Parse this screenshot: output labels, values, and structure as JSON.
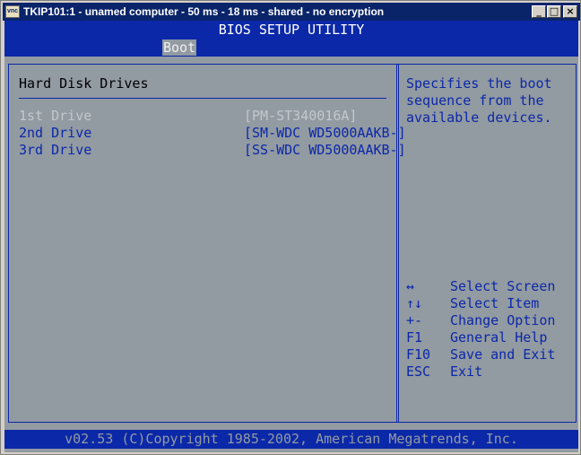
{
  "window": {
    "title": "TKIP101:1 - unamed computer - 50 ms - 18 ms - shared - no encryption",
    "icon_label": "vnc",
    "minimize_glyph": "_",
    "maximize_glyph": "□",
    "close_glyph": "×"
  },
  "bios": {
    "header": "BIOS SETUP UTILITY",
    "menu": {
      "boot_label": "Boot"
    },
    "section_title": "Hard Disk Drives",
    "drives": [
      {
        "label": "1st Drive",
        "value": "[PM-ST340016A]"
      },
      {
        "label": "2nd Drive",
        "value": "[SM-WDC WD5000AAKB-]"
      },
      {
        "label": "3rd Drive",
        "value": "[SS-WDC WD5000AAKB-]"
      }
    ],
    "help_text": "Specifies the boot sequence from the available devices.",
    "keys": [
      {
        "key": "↔",
        "desc": "Select Screen"
      },
      {
        "key": "↑↓",
        "desc": "Select Item"
      },
      {
        "key": "+-",
        "desc": "Change Option"
      },
      {
        "key": "F1",
        "desc": "General Help"
      },
      {
        "key": "F10",
        "desc": "Save and Exit"
      },
      {
        "key": "ESC",
        "desc": "Exit"
      }
    ],
    "footer": "v02.53 (C)Copyright 1985-2002, American Megatrends, Inc."
  },
  "colors": {
    "bios_blue": "#0b28a8",
    "bios_gray": "#929aa2",
    "titlebar": "#0a246a"
  }
}
